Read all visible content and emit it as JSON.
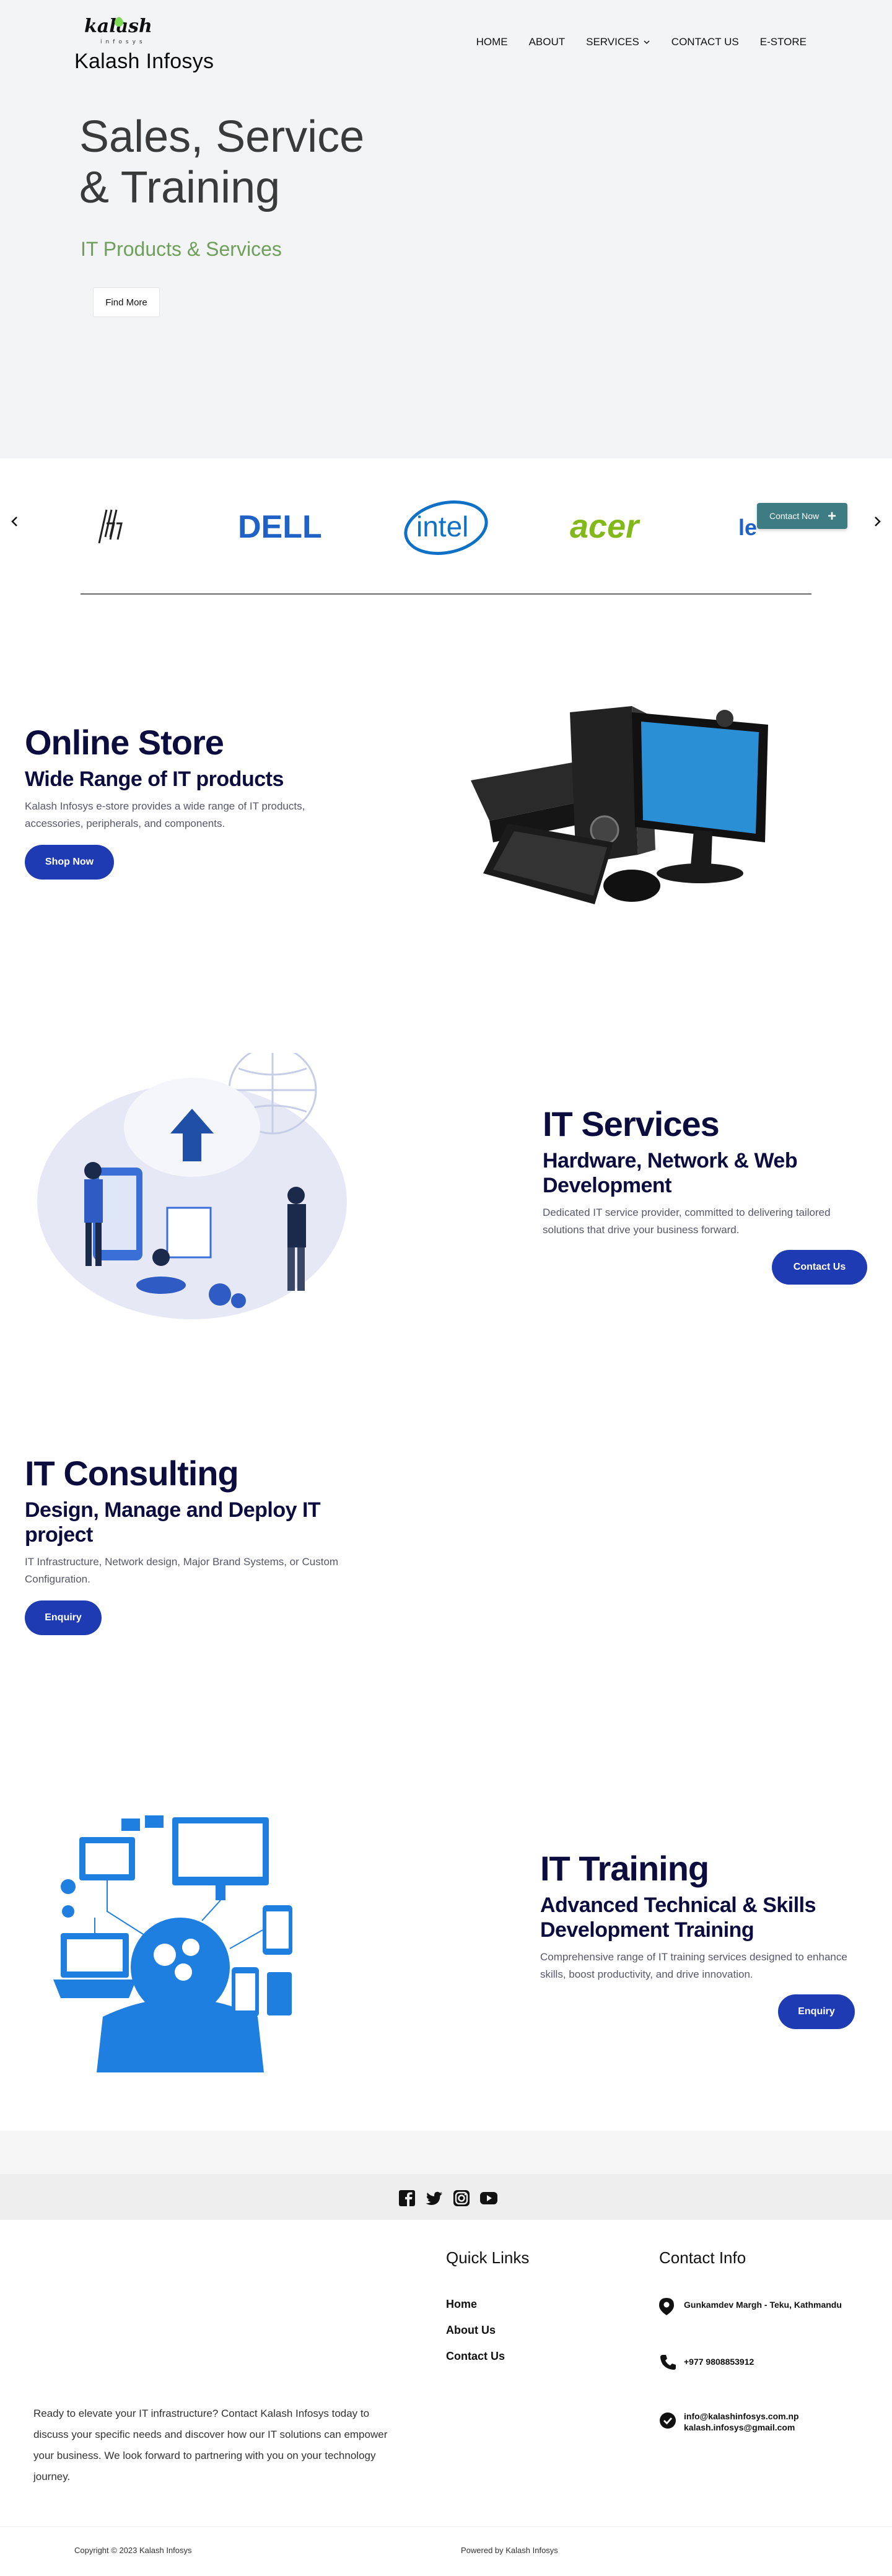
{
  "header": {
    "logo_wordmark": "kalash",
    "logo_tagline": "infosys",
    "brand_name": "Kalash Infosys",
    "nav": [
      {
        "label": "HOME"
      },
      {
        "label": "ABOUT"
      },
      {
        "label": "SERVICES"
      },
      {
        "label": "CONTACT US"
      },
      {
        "label": "E-STORE"
      }
    ]
  },
  "hero": {
    "title": "Sales, Service & Training",
    "subtitle": "IT Products & Services",
    "button": "Find More",
    "subtitle_color": "#6fa05a"
  },
  "brands": {
    "items": [
      {
        "name": "hp"
      },
      {
        "name": "DELL"
      },
      {
        "name": "intel"
      },
      {
        "name": "acer"
      },
      {
        "name": "le"
      }
    ],
    "floating_button": "Contact Now"
  },
  "online_store": {
    "title": "Online Store",
    "subtitle": "Wide Range of IT products",
    "text": "Kalash Infosys e-store provides a wide range of IT products, accessories, peripherals, and components.",
    "button": "Shop Now"
  },
  "it_services": {
    "title": "IT Services",
    "subtitle": "Hardware, Network & Web Development",
    "text": "Dedicated IT service provider, committed to delivering tailored solutions that drive your business forward.",
    "button": "Contact Us"
  },
  "it_consulting": {
    "title": "IT Consulting",
    "subtitle": "Design, Manage and Deploy IT project",
    "text": "IT Infrastructure, Network design, Major Brand Systems, or Custom Configuration.",
    "button": "Enquiry"
  },
  "it_training": {
    "title": "IT Training",
    "subtitle": "Advanced Technical & Skills Development Training",
    "text": "Comprehensive range of IT training services designed to enhance skills, boost productivity, and drive innovation.",
    "button": "Enquiry"
  },
  "footer": {
    "social": [
      "facebook-icon",
      "twitter-icon",
      "instagram-icon",
      "youtube-icon"
    ],
    "quick_links_title": "Quick Links",
    "quick_links": [
      {
        "label": "Home"
      },
      {
        "label": "About Us"
      },
      {
        "label": "Contact Us"
      }
    ],
    "contact_title": "Contact Info",
    "address": "Gunkamdev Margh - Teku, Kathmandu",
    "phone": "+977 9808853912",
    "email_1": "info@kalashinfosys.com.np",
    "email_2": "kalash.infosys@gmail.com",
    "cta": "Ready to elevate your IT infrastructure? Contact Kalash Infosys today to discuss your specific needs and discover how our IT solutions can empower your business. We look forward to partnering with you on your technology journey.",
    "copyright": "Copyright © 2023 Kalash Infosys",
    "powered_by": "Powered by Kalash Infosys"
  },
  "colors": {
    "primary_button": "#1f3bb3",
    "heading": "#0c0c3e",
    "contact_now": "#3e7c83",
    "dell": "#1f61c4",
    "intel": "#0f71c5",
    "acer": "#83b81a"
  }
}
